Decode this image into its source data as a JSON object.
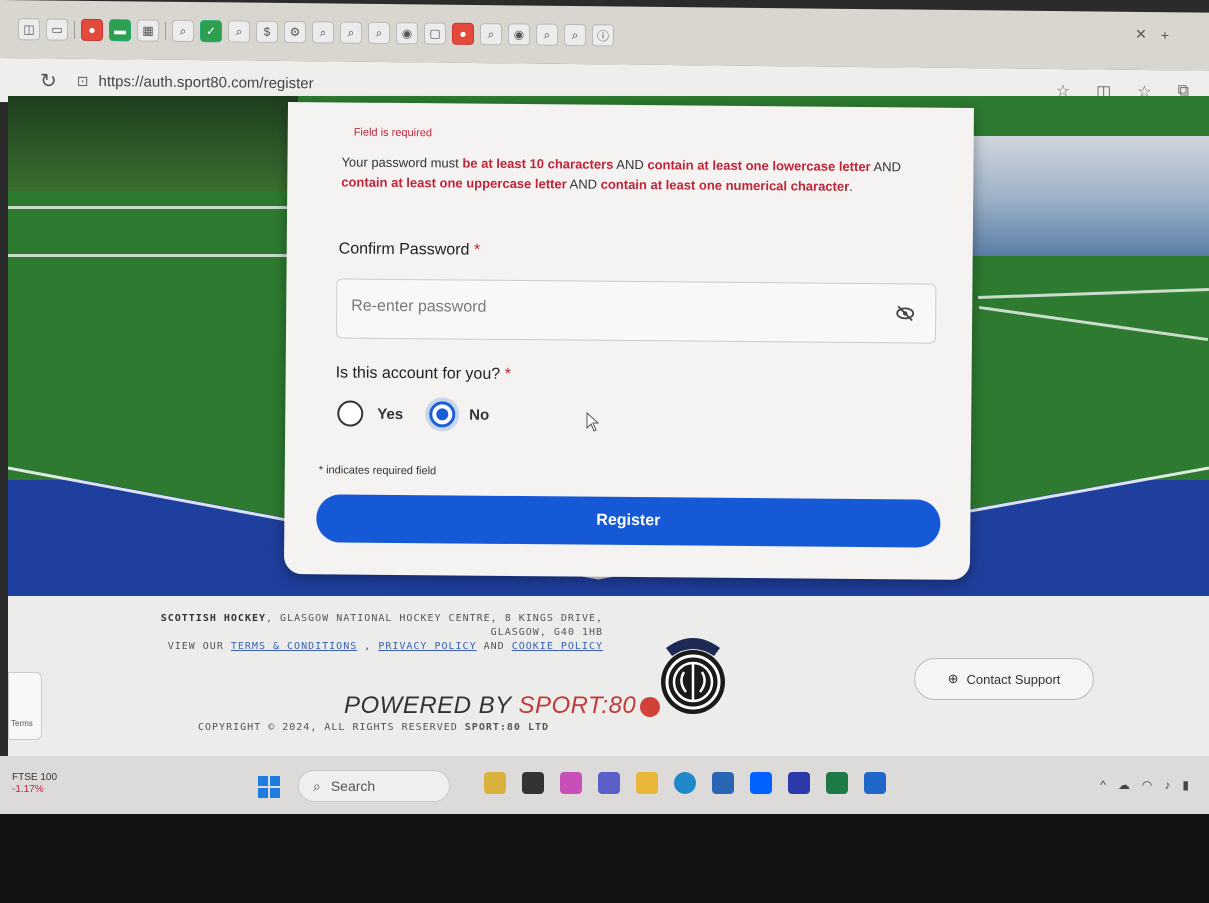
{
  "browser": {
    "url": "https://auth.sport80.com/register"
  },
  "form": {
    "field_error": "Field is required",
    "password_rules": {
      "prefix": "Your password must ",
      "rule1": "be at least 10 characters",
      "and1": " AND ",
      "rule2": "contain at least one lowercase letter",
      "and2": " AND ",
      "rule3": "contain at least one uppercase letter",
      "and3": " AND ",
      "rule4": "contain at least one numerical character",
      "suffix": "."
    },
    "confirm_label": "Confirm Password",
    "required_mark": "*",
    "confirm_placeholder": "Re-enter password",
    "account_question": "Is this account for you?",
    "options": [
      {
        "label": "Yes",
        "selected": false
      },
      {
        "label": "No",
        "selected": true
      }
    ],
    "required_note": "* indicates required field",
    "register_label": "Register"
  },
  "footer": {
    "org": "SCOTTISH HOCKEY",
    "address": ", GLASGOW NATIONAL HOCKEY CENTRE, 8 KINGS DRIVE, GLASGOW, G40 1HB",
    "view_our": "VIEW OUR ",
    "terms": "TERMS & CONDITIONS",
    "comma": " , ",
    "privacy": "PRIVACY POLICY",
    "and": " AND ",
    "cookie": "COOKIE POLICY",
    "powered_prefix": "POWERED BY ",
    "powered_brand": "SPORT:80",
    "copyright_prefix": "COPYRIGHT © 2024, ALL RIGHTS RESERVED ",
    "copyright_brand": "SPORT:80 LTD",
    "support_label": "Contact Support",
    "terms_widget": "Terms"
  },
  "taskbar": {
    "ftse_label": "FTSE 100",
    "ftse_change": "-1.17%",
    "search_label": "Search"
  },
  "colors": {
    "accent": "#1559d6",
    "error": "#c0243a",
    "brand_red": "#c23a3a"
  }
}
